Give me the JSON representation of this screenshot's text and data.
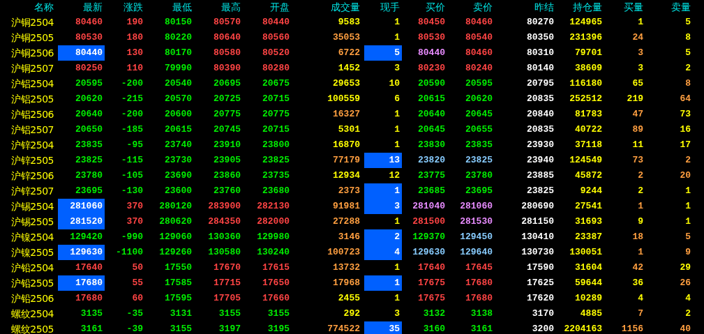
{
  "columns": [
    "名称",
    "最新",
    "涨跌",
    "最低",
    "最高",
    "开盘",
    "成交量",
    "现手",
    "买价",
    "卖价",
    "昨结",
    "持仓量",
    "买量",
    "卖量"
  ],
  "rows": [
    {
      "name": "沪铜2504",
      "cells": [
        {
          "text": "80460",
          "color": "#ff4444",
          "highlighted": false
        },
        {
          "text": "190",
          "color": "#ff4444",
          "highlighted": false
        },
        {
          "text": "80150",
          "color": "#00ee00",
          "highlighted": false
        },
        {
          "text": "80570",
          "color": "#ff4444",
          "highlighted": false
        },
        {
          "text": "80440",
          "color": "#ff4444",
          "highlighted": false
        },
        {
          "text": "9583",
          "color": "#ffff00",
          "highlighted": false
        },
        {
          "text": "1",
          "color": "#ffff00",
          "highlighted": false
        },
        {
          "text": "80450",
          "color": "#ff4444",
          "highlighted": false
        },
        {
          "text": "80460",
          "color": "#ff4444",
          "highlighted": false
        },
        {
          "text": "80270",
          "color": "#ffffff",
          "highlighted": false
        },
        {
          "text": "124965",
          "color": "#ffff00",
          "highlighted": false
        },
        {
          "text": "1",
          "color": "#ffff00",
          "highlighted": false
        },
        {
          "text": "5",
          "color": "#ffff00",
          "highlighted": false
        }
      ]
    },
    {
      "name": "沪铜2505",
      "cells": [
        {
          "text": "80530",
          "color": "#ff4444",
          "highlighted": false
        },
        {
          "text": "180",
          "color": "#ff4444",
          "highlighted": false
        },
        {
          "text": "80220",
          "color": "#00ee00",
          "highlighted": false
        },
        {
          "text": "80640",
          "color": "#ff4444",
          "highlighted": false
        },
        {
          "text": "80560",
          "color": "#ff4444",
          "highlighted": false
        },
        {
          "text": "35053",
          "color": "#ff9f40",
          "highlighted": false
        },
        {
          "text": "1",
          "color": "#ffff00",
          "highlighted": false
        },
        {
          "text": "80530",
          "color": "#ff4444",
          "highlighted": false
        },
        {
          "text": "80540",
          "color": "#ff4444",
          "highlighted": false
        },
        {
          "text": "80350",
          "color": "#ffffff",
          "highlighted": false
        },
        {
          "text": "231396",
          "color": "#ffff00",
          "highlighted": false
        },
        {
          "text": "24",
          "color": "#ff9f40",
          "highlighted": false
        },
        {
          "text": "8",
          "color": "#ffff00",
          "highlighted": false
        }
      ]
    },
    {
      "name": "沪铜2506",
      "cells": [
        {
          "text": "80440",
          "color": "#ffffff",
          "highlighted": true
        },
        {
          "text": "130",
          "color": "#ff4444",
          "highlighted": false
        },
        {
          "text": "80170",
          "color": "#00ee00",
          "highlighted": false
        },
        {
          "text": "80580",
          "color": "#ff4444",
          "highlighted": false
        },
        {
          "text": "80520",
          "color": "#ff4444",
          "highlighted": false
        },
        {
          "text": "6722",
          "color": "#ff9f40",
          "highlighted": false
        },
        {
          "text": "5",
          "color": "#ffffff",
          "highlighted": true
        },
        {
          "text": "80440",
          "color": "#e88cff",
          "highlighted": false
        },
        {
          "text": "80460",
          "color": "#ff4444",
          "highlighted": false
        },
        {
          "text": "80310",
          "color": "#ffffff",
          "highlighted": false
        },
        {
          "text": "79701",
          "color": "#ffff00",
          "highlighted": false
        },
        {
          "text": "3",
          "color": "#ff9f40",
          "highlighted": false
        },
        {
          "text": "5",
          "color": "#ffff00",
          "highlighted": false
        }
      ]
    },
    {
      "name": "沪铜2507",
      "cells": [
        {
          "text": "80250",
          "color": "#ff4444",
          "highlighted": false
        },
        {
          "text": "110",
          "color": "#ff4444",
          "highlighted": false
        },
        {
          "text": "79990",
          "color": "#00ee00",
          "highlighted": false
        },
        {
          "text": "80390",
          "color": "#ff4444",
          "highlighted": false
        },
        {
          "text": "80280",
          "color": "#ff4444",
          "highlighted": false
        },
        {
          "text": "1452",
          "color": "#ffff00",
          "highlighted": false
        },
        {
          "text": "3",
          "color": "#ffff00",
          "highlighted": false
        },
        {
          "text": "80230",
          "color": "#ff4444",
          "highlighted": false
        },
        {
          "text": "80240",
          "color": "#ff4444",
          "highlighted": false
        },
        {
          "text": "80140",
          "color": "#ffffff",
          "highlighted": false
        },
        {
          "text": "38609",
          "color": "#ffff00",
          "highlighted": false
        },
        {
          "text": "3",
          "color": "#ffff00",
          "highlighted": false
        },
        {
          "text": "2",
          "color": "#ffff00",
          "highlighted": false
        }
      ]
    },
    {
      "name": "沪铝2504",
      "cells": [
        {
          "text": "20595",
          "color": "#00ee00",
          "highlighted": false
        },
        {
          "text": "-200",
          "color": "#00ee00",
          "highlighted": false
        },
        {
          "text": "20540",
          "color": "#00ee00",
          "highlighted": false
        },
        {
          "text": "20695",
          "color": "#00ee00",
          "highlighted": false
        },
        {
          "text": "20675",
          "color": "#00ee00",
          "highlighted": false
        },
        {
          "text": "29653",
          "color": "#ffff00",
          "highlighted": false
        },
        {
          "text": "10",
          "color": "#ffff00",
          "highlighted": false
        },
        {
          "text": "20590",
          "color": "#00ee00",
          "highlighted": false
        },
        {
          "text": "20595",
          "color": "#00ee00",
          "highlighted": false
        },
        {
          "text": "20795",
          "color": "#ffffff",
          "highlighted": false
        },
        {
          "text": "116180",
          "color": "#ffff00",
          "highlighted": false
        },
        {
          "text": "65",
          "color": "#ffff00",
          "highlighted": false
        },
        {
          "text": "8",
          "color": "#ff9f40",
          "highlighted": false
        }
      ]
    },
    {
      "name": "沪铝2505",
      "cells": [
        {
          "text": "20620",
          "color": "#00ee00",
          "highlighted": false
        },
        {
          "text": "-215",
          "color": "#00ee00",
          "highlighted": false
        },
        {
          "text": "20570",
          "color": "#00ee00",
          "highlighted": false
        },
        {
          "text": "20725",
          "color": "#00ee00",
          "highlighted": false
        },
        {
          "text": "20715",
          "color": "#00ee00",
          "highlighted": false
        },
        {
          "text": "100559",
          "color": "#ffff00",
          "highlighted": false
        },
        {
          "text": "6",
          "color": "#ffff00",
          "highlighted": false
        },
        {
          "text": "20615",
          "color": "#00ee00",
          "highlighted": false
        },
        {
          "text": "20620",
          "color": "#00ee00",
          "highlighted": false
        },
        {
          "text": "20835",
          "color": "#ffffff",
          "highlighted": false
        },
        {
          "text": "252512",
          "color": "#ffff00",
          "highlighted": false
        },
        {
          "text": "219",
          "color": "#ffff00",
          "highlighted": false
        },
        {
          "text": "64",
          "color": "#ff9f40",
          "highlighted": false
        }
      ]
    },
    {
      "name": "沪铝2506",
      "cells": [
        {
          "text": "20640",
          "color": "#00ee00",
          "highlighted": false
        },
        {
          "text": "-200",
          "color": "#00ee00",
          "highlighted": false
        },
        {
          "text": "20600",
          "color": "#00ee00",
          "highlighted": false
        },
        {
          "text": "20775",
          "color": "#00ee00",
          "highlighted": false
        },
        {
          "text": "20775",
          "color": "#00ee00",
          "highlighted": false
        },
        {
          "text": "16327",
          "color": "#ff9f40",
          "highlighted": false
        },
        {
          "text": "1",
          "color": "#ffff00",
          "highlighted": false
        },
        {
          "text": "20640",
          "color": "#00ee00",
          "highlighted": false
        },
        {
          "text": "20645",
          "color": "#00ee00",
          "highlighted": false
        },
        {
          "text": "20840",
          "color": "#ffffff",
          "highlighted": false
        },
        {
          "text": "81783",
          "color": "#ffff00",
          "highlighted": false
        },
        {
          "text": "47",
          "color": "#ff9f40",
          "highlighted": false
        },
        {
          "text": "73",
          "color": "#ffff00",
          "highlighted": false
        }
      ]
    },
    {
      "name": "沪铝2507",
      "cells": [
        {
          "text": "20650",
          "color": "#00ee00",
          "highlighted": false
        },
        {
          "text": "-185",
          "color": "#00ee00",
          "highlighted": false
        },
        {
          "text": "20615",
          "color": "#00ee00",
          "highlighted": false
        },
        {
          "text": "20745",
          "color": "#00ee00",
          "highlighted": false
        },
        {
          "text": "20715",
          "color": "#00ee00",
          "highlighted": false
        },
        {
          "text": "5301",
          "color": "#ffff00",
          "highlighted": false
        },
        {
          "text": "1",
          "color": "#ffff00",
          "highlighted": false
        },
        {
          "text": "20645",
          "color": "#00ee00",
          "highlighted": false
        },
        {
          "text": "20655",
          "color": "#00ee00",
          "highlighted": false
        },
        {
          "text": "20835",
          "color": "#ffffff",
          "highlighted": false
        },
        {
          "text": "40722",
          "color": "#ffff00",
          "highlighted": false
        },
        {
          "text": "89",
          "color": "#ff9f40",
          "highlighted": false
        },
        {
          "text": "16",
          "color": "#ffff00",
          "highlighted": false
        }
      ]
    },
    {
      "name": "沪锌2504",
      "cells": [
        {
          "text": "23835",
          "color": "#00ee00",
          "highlighted": false
        },
        {
          "text": "-95",
          "color": "#00ee00",
          "highlighted": false
        },
        {
          "text": "23740",
          "color": "#00ee00",
          "highlighted": false
        },
        {
          "text": "23910",
          "color": "#00ee00",
          "highlighted": false
        },
        {
          "text": "23800",
          "color": "#00ee00",
          "highlighted": false
        },
        {
          "text": "16870",
          "color": "#ffff00",
          "highlighted": false
        },
        {
          "text": "1",
          "color": "#ffff00",
          "highlighted": false
        },
        {
          "text": "23830",
          "color": "#00ee00",
          "highlighted": false
        },
        {
          "text": "23835",
          "color": "#00ee00",
          "highlighted": false
        },
        {
          "text": "23930",
          "color": "#ffffff",
          "highlighted": false
        },
        {
          "text": "37118",
          "color": "#ffff00",
          "highlighted": false
        },
        {
          "text": "11",
          "color": "#ffff00",
          "highlighted": false
        },
        {
          "text": "17",
          "color": "#ffff00",
          "highlighted": false
        }
      ]
    },
    {
      "name": "沪锌2505",
      "cells": [
        {
          "text": "23825",
          "color": "#00ee00",
          "highlighted": false
        },
        {
          "text": "-115",
          "color": "#00ee00",
          "highlighted": false
        },
        {
          "text": "23730",
          "color": "#00ee00",
          "highlighted": false
        },
        {
          "text": "23905",
          "color": "#00ee00",
          "highlighted": false
        },
        {
          "text": "23825",
          "color": "#00ee00",
          "highlighted": false
        },
        {
          "text": "77179",
          "color": "#ff9f40",
          "highlighted": false
        },
        {
          "text": "13",
          "color": "#ffffff",
          "highlighted": true
        },
        {
          "text": "23820",
          "color": "#88ccff",
          "highlighted": false
        },
        {
          "text": "23825",
          "color": "#88ccff",
          "highlighted": false
        },
        {
          "text": "23940",
          "color": "#ffffff",
          "highlighted": false
        },
        {
          "text": "124549",
          "color": "#ffff00",
          "highlighted": false
        },
        {
          "text": "73",
          "color": "#ff9f40",
          "highlighted": false
        },
        {
          "text": "2",
          "color": "#ff9f40",
          "highlighted": false
        }
      ]
    },
    {
      "name": "沪锌2506",
      "cells": [
        {
          "text": "23780",
          "color": "#00ee00",
          "highlighted": false
        },
        {
          "text": "-105",
          "color": "#00ee00",
          "highlighted": false
        },
        {
          "text": "23690",
          "color": "#00ee00",
          "highlighted": false
        },
        {
          "text": "23860",
          "color": "#00ee00",
          "highlighted": false
        },
        {
          "text": "23735",
          "color": "#00ee00",
          "highlighted": false
        },
        {
          "text": "12934",
          "color": "#ffff00",
          "highlighted": false
        },
        {
          "text": "12",
          "color": "#ffff00",
          "highlighted": false
        },
        {
          "text": "23775",
          "color": "#00ee00",
          "highlighted": false
        },
        {
          "text": "23780",
          "color": "#00ee00",
          "highlighted": false
        },
        {
          "text": "23885",
          "color": "#ffffff",
          "highlighted": false
        },
        {
          "text": "45872",
          "color": "#ffff00",
          "highlighted": false
        },
        {
          "text": "2",
          "color": "#ff9f40",
          "highlighted": false
        },
        {
          "text": "20",
          "color": "#ff9f40",
          "highlighted": false
        }
      ]
    },
    {
      "name": "沪锌2507",
      "cells": [
        {
          "text": "23695",
          "color": "#00ee00",
          "highlighted": false
        },
        {
          "text": "-130",
          "color": "#00ee00",
          "highlighted": false
        },
        {
          "text": "23600",
          "color": "#00ee00",
          "highlighted": false
        },
        {
          "text": "23760",
          "color": "#00ee00",
          "highlighted": false
        },
        {
          "text": "23680",
          "color": "#00ee00",
          "highlighted": false
        },
        {
          "text": "2373",
          "color": "#ff9f40",
          "highlighted": false
        },
        {
          "text": "1",
          "color": "#ffffff",
          "highlighted": true
        },
        {
          "text": "23685",
          "color": "#00ee00",
          "highlighted": false
        },
        {
          "text": "23695",
          "color": "#00ee00",
          "highlighted": false
        },
        {
          "text": "23825",
          "color": "#ffffff",
          "highlighted": false
        },
        {
          "text": "9244",
          "color": "#ffff00",
          "highlighted": false
        },
        {
          "text": "2",
          "color": "#ffff00",
          "highlighted": false
        },
        {
          "text": "1",
          "color": "#ffff00",
          "highlighted": false
        }
      ]
    },
    {
      "name": "沪锡2504",
      "cells": [
        {
          "text": "281060",
          "color": "#ffffff",
          "highlighted": true
        },
        {
          "text": "370",
          "color": "#ff4444",
          "highlighted": false
        },
        {
          "text": "280120",
          "color": "#00ee00",
          "highlighted": false
        },
        {
          "text": "283900",
          "color": "#ff4444",
          "highlighted": false
        },
        {
          "text": "282130",
          "color": "#ff4444",
          "highlighted": false
        },
        {
          "text": "91981",
          "color": "#ff9f40",
          "highlighted": false
        },
        {
          "text": "3",
          "color": "#ffffff",
          "highlighted": true
        },
        {
          "text": "281040",
          "color": "#e88cff",
          "highlighted": false
        },
        {
          "text": "281060",
          "color": "#e88cff",
          "highlighted": false
        },
        {
          "text": "280690",
          "color": "#ffffff",
          "highlighted": false
        },
        {
          "text": "27541",
          "color": "#ffff00",
          "highlighted": false
        },
        {
          "text": "1",
          "color": "#ff9f40",
          "highlighted": false
        },
        {
          "text": "1",
          "color": "#ffff00",
          "highlighted": false
        }
      ]
    },
    {
      "name": "沪锡2505",
      "cells": [
        {
          "text": "281520",
          "color": "#ffffff",
          "highlighted": true
        },
        {
          "text": "370",
          "color": "#ff4444",
          "highlighted": false
        },
        {
          "text": "280620",
          "color": "#00ee00",
          "highlighted": false
        },
        {
          "text": "284350",
          "color": "#ff4444",
          "highlighted": false
        },
        {
          "text": "282000",
          "color": "#ff4444",
          "highlighted": false
        },
        {
          "text": "27288",
          "color": "#ff9f40",
          "highlighted": false
        },
        {
          "text": "1",
          "color": "#ffff00",
          "highlighted": false
        },
        {
          "text": "281500",
          "color": "#ff4444",
          "highlighted": false
        },
        {
          "text": "281530",
          "color": "#e88cff",
          "highlighted": false
        },
        {
          "text": "281150",
          "color": "#ffffff",
          "highlighted": false
        },
        {
          "text": "31693",
          "color": "#ffff00",
          "highlighted": false
        },
        {
          "text": "9",
          "color": "#ffff00",
          "highlighted": false
        },
        {
          "text": "1",
          "color": "#ffff00",
          "highlighted": false
        }
      ]
    },
    {
      "name": "沪镍2504",
      "cells": [
        {
          "text": "129420",
          "color": "#00ee00",
          "highlighted": false
        },
        {
          "text": "-990",
          "color": "#00ee00",
          "highlighted": false
        },
        {
          "text": "129060",
          "color": "#00ee00",
          "highlighted": false
        },
        {
          "text": "130360",
          "color": "#00ee00",
          "highlighted": false
        },
        {
          "text": "129980",
          "color": "#00ee00",
          "highlighted": false
        },
        {
          "text": "3146",
          "color": "#ff9f40",
          "highlighted": false
        },
        {
          "text": "2",
          "color": "#ffffff",
          "highlighted": true
        },
        {
          "text": "129370",
          "color": "#00ee00",
          "highlighted": false
        },
        {
          "text": "129450",
          "color": "#88ccff",
          "highlighted": false
        },
        {
          "text": "130410",
          "color": "#ffffff",
          "highlighted": false
        },
        {
          "text": "23387",
          "color": "#ffff00",
          "highlighted": false
        },
        {
          "text": "18",
          "color": "#ff9f40",
          "highlighted": false
        },
        {
          "text": "5",
          "color": "#ff9f40",
          "highlighted": false
        }
      ]
    },
    {
      "name": "沪镍2505",
      "cells": [
        {
          "text": "129630",
          "color": "#ffffff",
          "highlighted": true
        },
        {
          "text": "-1100",
          "color": "#00ee00",
          "highlighted": false
        },
        {
          "text": "129260",
          "color": "#00ee00",
          "highlighted": false
        },
        {
          "text": "130580",
          "color": "#00ee00",
          "highlighted": false
        },
        {
          "text": "130240",
          "color": "#00ee00",
          "highlighted": false
        },
        {
          "text": "100723",
          "color": "#ff9f40",
          "highlighted": false
        },
        {
          "text": "4",
          "color": "#ffffff",
          "highlighted": true
        },
        {
          "text": "129630",
          "color": "#88ccff",
          "highlighted": false
        },
        {
          "text": "129640",
          "color": "#88ccff",
          "highlighted": false
        },
        {
          "text": "130730",
          "color": "#ffffff",
          "highlighted": false
        },
        {
          "text": "130051",
          "color": "#ffff00",
          "highlighted": false
        },
        {
          "text": "1",
          "color": "#ff9f40",
          "highlighted": false
        },
        {
          "text": "9",
          "color": "#ff9f40",
          "highlighted": false
        }
      ]
    },
    {
      "name": "沪铅2504",
      "cells": [
        {
          "text": "17640",
          "color": "#ff4444",
          "highlighted": false
        },
        {
          "text": "50",
          "color": "#ff4444",
          "highlighted": false
        },
        {
          "text": "17550",
          "color": "#00ee00",
          "highlighted": false
        },
        {
          "text": "17670",
          "color": "#ff4444",
          "highlighted": false
        },
        {
          "text": "17615",
          "color": "#ff4444",
          "highlighted": false
        },
        {
          "text": "13732",
          "color": "#ff9f40",
          "highlighted": false
        },
        {
          "text": "1",
          "color": "#ffff00",
          "highlighted": false
        },
        {
          "text": "17640",
          "color": "#ff4444",
          "highlighted": false
        },
        {
          "text": "17645",
          "color": "#ff4444",
          "highlighted": false
        },
        {
          "text": "17590",
          "color": "#ffffff",
          "highlighted": false
        },
        {
          "text": "31604",
          "color": "#ffff00",
          "highlighted": false
        },
        {
          "text": "42",
          "color": "#ff9f40",
          "highlighted": false
        },
        {
          "text": "29",
          "color": "#ffff00",
          "highlighted": false
        }
      ]
    },
    {
      "name": "沪铅2505",
      "cells": [
        {
          "text": "17680",
          "color": "#ffffff",
          "highlighted": true
        },
        {
          "text": "55",
          "color": "#ff4444",
          "highlighted": false
        },
        {
          "text": "17585",
          "color": "#00ee00",
          "highlighted": false
        },
        {
          "text": "17715",
          "color": "#ff4444",
          "highlighted": false
        },
        {
          "text": "17650",
          "color": "#ff4444",
          "highlighted": false
        },
        {
          "text": "17968",
          "color": "#ff9f40",
          "highlighted": false
        },
        {
          "text": "1",
          "color": "#ffffff",
          "highlighted": true
        },
        {
          "text": "17675",
          "color": "#ff4444",
          "highlighted": false
        },
        {
          "text": "17680",
          "color": "#ff4444",
          "highlighted": false
        },
        {
          "text": "17625",
          "color": "#ffffff",
          "highlighted": false
        },
        {
          "text": "59644",
          "color": "#ffff00",
          "highlighted": false
        },
        {
          "text": "36",
          "color": "#ffff00",
          "highlighted": false
        },
        {
          "text": "26",
          "color": "#ff9f40",
          "highlighted": false
        }
      ]
    },
    {
      "name": "沪铅2506",
      "cells": [
        {
          "text": "17680",
          "color": "#ff4444",
          "highlighted": false
        },
        {
          "text": "60",
          "color": "#ff4444",
          "highlighted": false
        },
        {
          "text": "17595",
          "color": "#00ee00",
          "highlighted": false
        },
        {
          "text": "17705",
          "color": "#ff4444",
          "highlighted": false
        },
        {
          "text": "17660",
          "color": "#ff4444",
          "highlighted": false
        },
        {
          "text": "2455",
          "color": "#ffff00",
          "highlighted": false
        },
        {
          "text": "1",
          "color": "#ffff00",
          "highlighted": false
        },
        {
          "text": "17675",
          "color": "#ff4444",
          "highlighted": false
        },
        {
          "text": "17680",
          "color": "#ff4444",
          "highlighted": false
        },
        {
          "text": "17620",
          "color": "#ffffff",
          "highlighted": false
        },
        {
          "text": "10289",
          "color": "#ffff00",
          "highlighted": false
        },
        {
          "text": "4",
          "color": "#ffff00",
          "highlighted": false
        },
        {
          "text": "4",
          "color": "#ffff00",
          "highlighted": false
        }
      ]
    },
    {
      "name": "螺纹2504",
      "cells": [
        {
          "text": "3135",
          "color": "#00ee00",
          "highlighted": false
        },
        {
          "text": "-35",
          "color": "#00ee00",
          "highlighted": false
        },
        {
          "text": "3131",
          "color": "#00ee00",
          "highlighted": false
        },
        {
          "text": "3155",
          "color": "#00ee00",
          "highlighted": false
        },
        {
          "text": "3155",
          "color": "#00ee00",
          "highlighted": false
        },
        {
          "text": "292",
          "color": "#ffff00",
          "highlighted": false
        },
        {
          "text": "3",
          "color": "#ffff00",
          "highlighted": false
        },
        {
          "text": "3132",
          "color": "#00ee00",
          "highlighted": false
        },
        {
          "text": "3138",
          "color": "#00ee00",
          "highlighted": false
        },
        {
          "text": "3170",
          "color": "#ffffff",
          "highlighted": false
        },
        {
          "text": "4885",
          "color": "#ffff00",
          "highlighted": false
        },
        {
          "text": "7",
          "color": "#ff9f40",
          "highlighted": false
        },
        {
          "text": "2",
          "color": "#ffff00",
          "highlighted": false
        }
      ]
    },
    {
      "name": "螺纹2505",
      "cells": [
        {
          "text": "3161",
          "color": "#00ee00",
          "highlighted": false
        },
        {
          "text": "-39",
          "color": "#00ee00",
          "highlighted": false
        },
        {
          "text": "3155",
          "color": "#00ee00",
          "highlighted": false
        },
        {
          "text": "3197",
          "color": "#00ee00",
          "highlighted": false
        },
        {
          "text": "3195",
          "color": "#00ee00",
          "highlighted": false
        },
        {
          "text": "774522",
          "color": "#ff9f40",
          "highlighted": false
        },
        {
          "text": "35",
          "color": "#ffffff",
          "highlighted": true
        },
        {
          "text": "3160",
          "color": "#00ee00",
          "highlighted": false
        },
        {
          "text": "3161",
          "color": "#00ee00",
          "highlighted": false
        },
        {
          "text": "3200",
          "color": "#ffffff",
          "highlighted": false
        },
        {
          "text": "2204163",
          "color": "#ffff00",
          "highlighted": false
        },
        {
          "text": "1156",
          "color": "#ff9f40",
          "highlighted": false
        },
        {
          "text": "40",
          "color": "#ff9f40",
          "highlighted": false
        }
      ]
    }
  ]
}
